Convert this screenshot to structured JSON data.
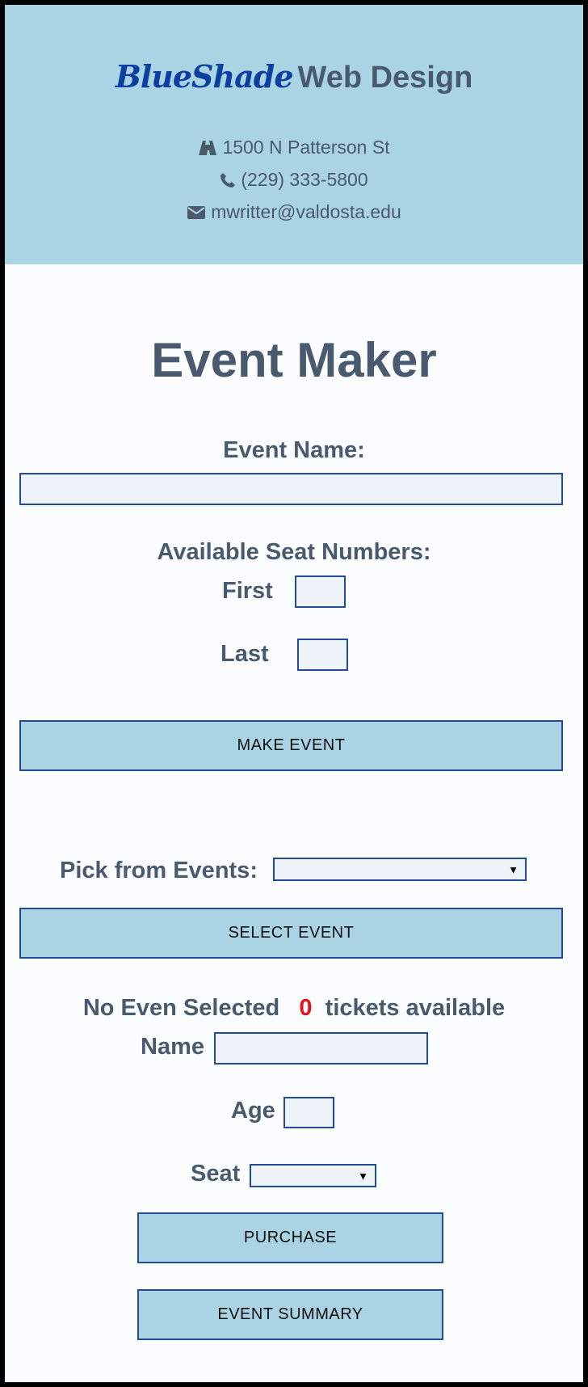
{
  "header": {
    "brand_script": "BlueShade",
    "brand_rest": "Web Design",
    "address": "1500 N Patterson St",
    "phone": "(229) 333-5800",
    "email": "mwritter@valdosta.edu"
  },
  "main": {
    "title": "Event Maker",
    "event_name_label": "Event Name:",
    "event_name_value": "",
    "seats_label": "Available Seat Numbers:",
    "first_label": "First",
    "first_value": "",
    "last_label": "Last",
    "last_value": "",
    "make_event_button": "MAKE EVENT",
    "pick_events_label": "Pick from Events:",
    "pick_events_selected": "",
    "select_event_button": "SELECT EVENT",
    "status_event": "No Even Selected",
    "status_count": "0",
    "status_suffix": "tickets available",
    "name_label": "Name",
    "name_value": "",
    "age_label": "Age",
    "age_value": "",
    "seat_label": "Seat",
    "seat_selected": "",
    "purchase_button": "PURCHASE",
    "summary_button": "EVENT SUMMARY"
  },
  "icons": [
    "road-icon",
    "phone-icon",
    "envelope-icon",
    "chevron-down-icon"
  ],
  "colors": {
    "header_bg": "#aad4e3",
    "text": "#4a5a6e",
    "brand": "#0d3fa0",
    "input_border": "#244a9a",
    "count": "#e8121b"
  }
}
